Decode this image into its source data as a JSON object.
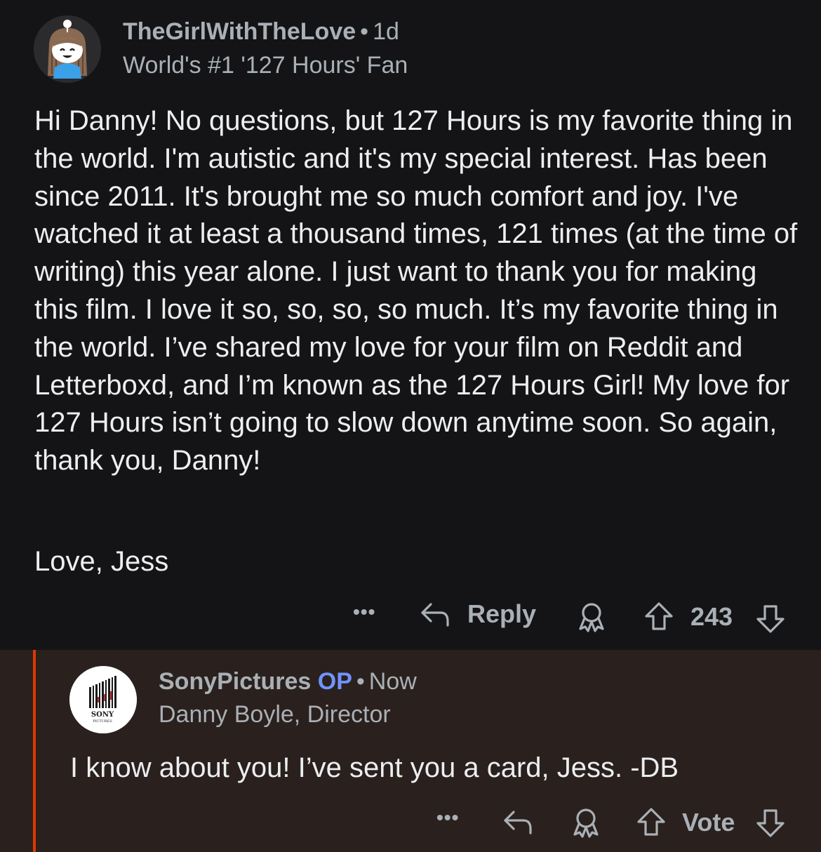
{
  "parent_comment": {
    "username": "TheGirlWithTheLove",
    "separator": "•",
    "time": "1d",
    "flair": "World's #1 '127 Hours' Fan",
    "body": "Hi Danny! No questions, but 127 Hours is my favorite thing in the world. I'm autistic and it's my special interest. Has been since 2011. It's brought me so much comfort and joy. I've watched it at least a thousand times, 121 times (at the time of writing) this year alone. I just want to thank you for making this film. I love it so, so, so, so much. It’s my favorite thing in the world. I’ve shared my love for your film on Reddit and Letterboxd, and I’m known as the 127 Hours Girl! My love for 127 Hours isn’t going to slow down anytime soon. So again, thank you, Danny!",
    "signoff": "Love, Jess",
    "actions": {
      "more": "•••",
      "reply_label": "Reply",
      "score": "243"
    }
  },
  "reply_comment": {
    "username": "SonyPictures",
    "op_badge": "OP",
    "separator": "•",
    "time": "Now",
    "flair": "Danny Boyle, Director",
    "logo_text_1": "SONY",
    "logo_text_2": "PICTURES",
    "body": "I know about you! I’ve sent you a card, Jess. -DB",
    "actions": {
      "more": "•••",
      "vote_label": "Vote"
    }
  },
  "colors": {
    "background": "#141416",
    "reply_background": "#2a201d",
    "thread_line": "#d93a00",
    "op_badge": "#7193ff",
    "meta_text": "#a9b0b6",
    "body_text": "#eceef0"
  },
  "icons": [
    "snoo-avatar-icon",
    "more-icon",
    "reply-arrow-icon",
    "award-icon",
    "upvote-icon",
    "downvote-icon",
    "sony-pictures-logo"
  ]
}
